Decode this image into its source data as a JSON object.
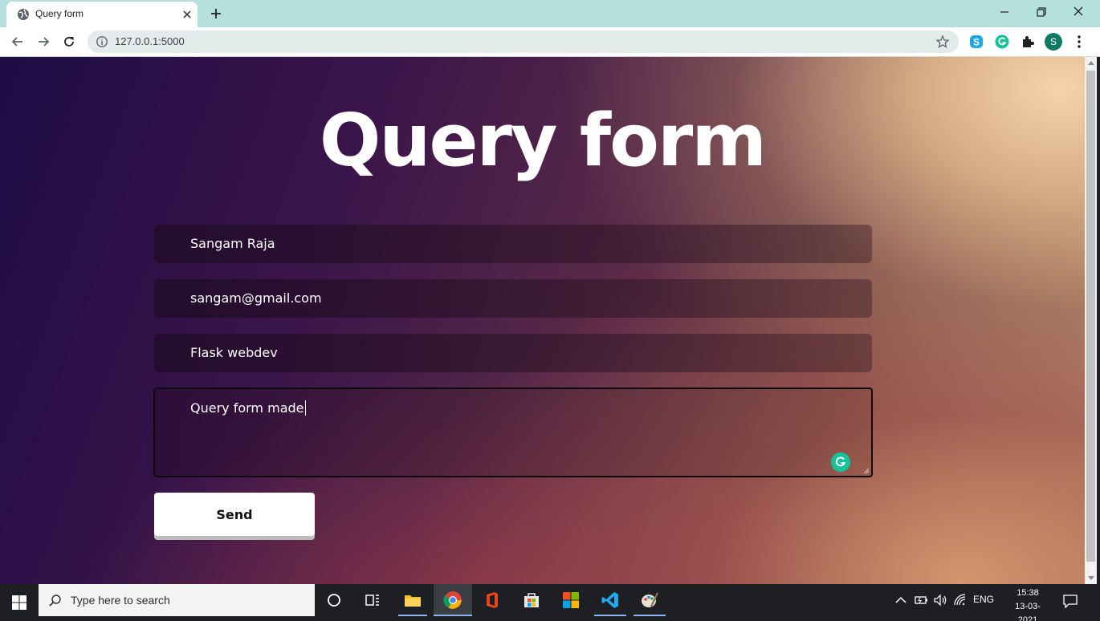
{
  "browser": {
    "tab_title": "Query form",
    "url": "127.0.0.1:5000",
    "profile_initial": "S"
  },
  "page": {
    "heading": "Query form",
    "form": {
      "name_value": "Sangam Raja",
      "email_value": "sangam@gmail.com",
      "subject_value": "Flask webdev",
      "message_value": "Query form made",
      "send_label": "Send"
    }
  },
  "taskbar": {
    "search_placeholder": "Type here to search",
    "language": "ENG",
    "time": "15:38",
    "date": "13-03-2021"
  },
  "colors": {
    "tab_strip": "#b4e0de",
    "grammarly": "#15c39a",
    "profile_avatar": "#0f7a63"
  }
}
